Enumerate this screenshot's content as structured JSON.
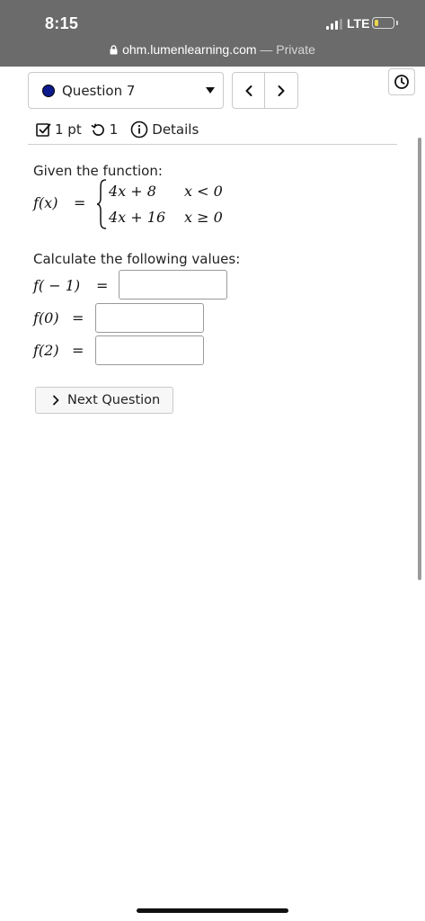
{
  "status_bar": {
    "time": "8:15",
    "network": "LTE",
    "battery_level": 0.2,
    "battery_color": "#e8d64a"
  },
  "browser": {
    "domain": "ohm.lumenlearning.com",
    "separator": " — ",
    "mode": "Private"
  },
  "question_nav": {
    "selected": "Question 7",
    "status_dot_color": "#0d1a8e"
  },
  "meta": {
    "points": "1 pt",
    "attempts": "1",
    "details": "Details"
  },
  "problem": {
    "intro": "Given the function:",
    "function_lhs": "f(x)",
    "equals": "=",
    "pieces": [
      {
        "expr": "4x + 8",
        "condition": "x < 0"
      },
      {
        "expr": "4x + 16",
        "condition": "x ≥ 0"
      }
    ],
    "prompt": "Calculate the following values:",
    "items": [
      {
        "label": "f( − 1)",
        "value": ""
      },
      {
        "label": "f(0)",
        "value": ""
      },
      {
        "label": "f(2)",
        "value": ""
      }
    ]
  },
  "actions": {
    "next_question": "Next Question"
  },
  "colors": {
    "status_bar_bg": "#6b6b6b",
    "divider": "#d0d0d0"
  }
}
